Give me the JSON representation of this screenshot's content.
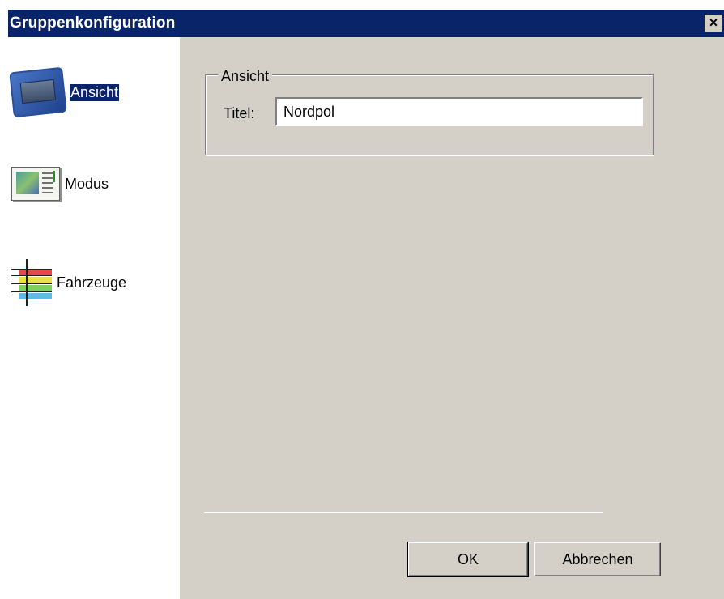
{
  "window": {
    "title": "Gruppenkonfiguration",
    "close_symbol": "×"
  },
  "sidebar": {
    "items": [
      {
        "label": "Ansicht",
        "icon": "ansicht-icon",
        "selected": true
      },
      {
        "label": "Modus",
        "icon": "modus-icon",
        "selected": false
      },
      {
        "label": "Fahrzeuge",
        "icon": "fahrzeuge-icon",
        "selected": false
      }
    ]
  },
  "ansicht_group": {
    "legend": "Ansicht",
    "title_label": "Titel:",
    "title_value": "Nordpol"
  },
  "buttons": {
    "ok": "OK",
    "cancel": "Abbrechen"
  },
  "colors": {
    "titlebar": "#0a246a",
    "dialog_face": "#d4d0c8",
    "selection": "#0a246a"
  }
}
